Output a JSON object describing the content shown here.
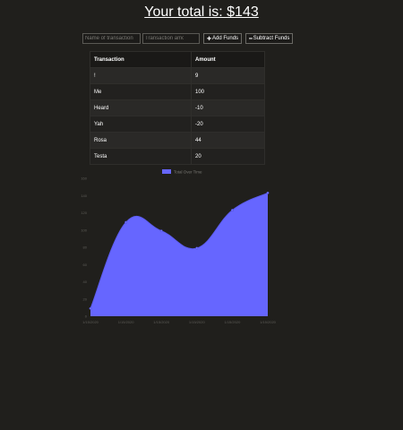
{
  "header": {
    "total_label": "Your total is: $143"
  },
  "form": {
    "name_placeholder": "Name of transaction",
    "amount_placeholder": "Transaction amount",
    "add_label": "Add Funds",
    "subtract_label": "Subtract Funds",
    "add_icon": "plus-icon",
    "subtract_icon": "minus-icon"
  },
  "table": {
    "headers": [
      "Transaction",
      "Amount"
    ],
    "rows": [
      {
        "name": "!",
        "amount": "9"
      },
      {
        "name": "Me",
        "amount": "100"
      },
      {
        "name": "Heard",
        "amount": "-10"
      },
      {
        "name": "Yah",
        "amount": "-20"
      },
      {
        "name": "Rosa",
        "amount": "44"
      },
      {
        "name": "Testa",
        "amount": "20"
      }
    ]
  },
  "chart_data": {
    "type": "area",
    "legend": "Total Over Time",
    "legend_position": "top",
    "x": [
      "1/15/2020",
      "1/15/2020",
      "1/15/2020",
      "1/15/2020",
      "1/15/2020",
      "1/15/2020"
    ],
    "series": [
      {
        "name": "Total Over Time",
        "values": [
          9,
          109,
          99,
          79,
          123,
          143
        ]
      }
    ],
    "yticks": [
      0,
      20,
      40,
      60,
      80,
      100,
      120,
      140,
      160
    ],
    "ylim": [
      0,
      160
    ],
    "fill_color": "#6666ff",
    "grid": false
  }
}
